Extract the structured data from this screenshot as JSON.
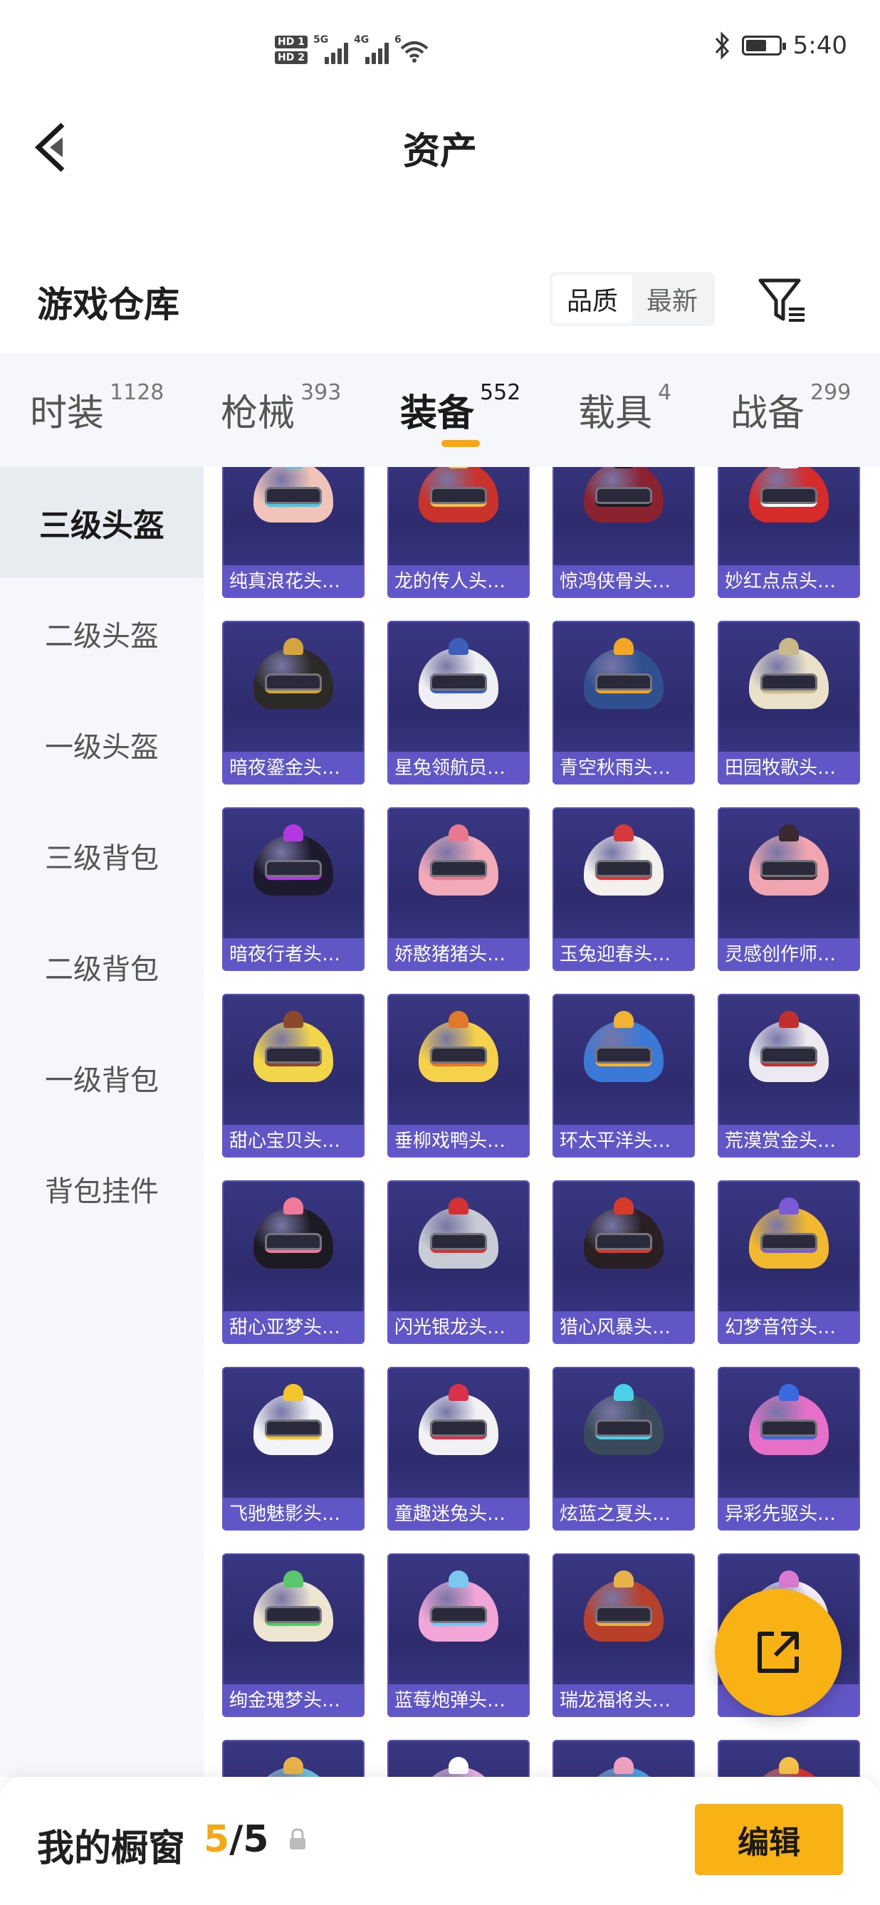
{
  "status_bar": {
    "hd1": "HD 1",
    "hd2": "HD 2",
    "net1": "5G",
    "net2": "4G",
    "wifi": "6",
    "time": "5:40"
  },
  "nav": {
    "title": "资产"
  },
  "warehouse": {
    "title": "游戏仓库",
    "sort_options": [
      "品质",
      "最新"
    ],
    "sort_selected": "品质"
  },
  "tabs": [
    {
      "label": "时装",
      "count": "1128"
    },
    {
      "label": "枪械",
      "count": "393"
    },
    {
      "label": "装备",
      "count": "552"
    },
    {
      "label": "载具",
      "count": "4"
    },
    {
      "label": "战备",
      "count": "299"
    }
  ],
  "active_tab": "装备",
  "sidebar": {
    "items": [
      "三级头盔",
      "二级头盔",
      "一级头盔",
      "三级背包",
      "二级背包",
      "一级背包",
      "背包挂件"
    ],
    "active": "三级头盔"
  },
  "items": [
    {
      "name": "纯真浪花头…",
      "color": "#f0c4b8",
      "accent": "#49c8e0"
    },
    {
      "name": "龙的传人头…",
      "color": "#c9332b",
      "accent": "#f0c14a"
    },
    {
      "name": "惊鸿侠骨头…",
      "color": "#8a2230",
      "accent": "#1c1c1c"
    },
    {
      "name": "妙红点点头…",
      "color": "#d62b2b",
      "accent": "#ffffff"
    },
    {
      "name": "暗夜鎏金头…",
      "color": "#2c2a26",
      "accent": "#d3a53c"
    },
    {
      "name": "星兔领航员…",
      "color": "#f0f0f4",
      "accent": "#3d5fb8"
    },
    {
      "name": "青空秋雨头…",
      "color": "#2f4f8f",
      "accent": "#f2a623"
    },
    {
      "name": "田园牧歌头…",
      "color": "#e9e2c8",
      "accent": "#c9b98a"
    },
    {
      "name": "暗夜行者头…",
      "color": "#1e1a2e",
      "accent": "#b23ae0"
    },
    {
      "name": "娇憨猪猪头…",
      "color": "#f2a9b8",
      "accent": "#e6788f"
    },
    {
      "name": "玉兔迎春头…",
      "color": "#f4f0ee",
      "accent": "#d63a3a"
    },
    {
      "name": "灵感创作师…",
      "color": "#f0a5b0",
      "accent": "#3a2a30"
    },
    {
      "name": "甜心宝贝头…",
      "color": "#f2d64a",
      "accent": "#8a4a2a"
    },
    {
      "name": "垂柳戏鸭头…",
      "color": "#f6d14a",
      "accent": "#e07a2a"
    },
    {
      "name": "环太平洋头…",
      "color": "#3a7ad6",
      "accent": "#f2b233"
    },
    {
      "name": "荒漠赏金头…",
      "color": "#eceaf0",
      "accent": "#c22f2f"
    },
    {
      "name": "甜心亚梦头…",
      "color": "#1c1a22",
      "accent": "#f07a9a"
    },
    {
      "name": "闪光银龙头…",
      "color": "#c8ccd4",
      "accent": "#d23232"
    },
    {
      "name": "猎心风暴头…",
      "color": "#2a2024",
      "accent": "#d83a2a"
    },
    {
      "name": "幻梦音符头…",
      "color": "#f2b82e",
      "accent": "#7a5ad6"
    },
    {
      "name": "飞驰魅影头…",
      "color": "#f4f4f8",
      "accent": "#f2c62a"
    },
    {
      "name": "童趣迷兔头…",
      "color": "#f2f2f4",
      "accent": "#d8324a"
    },
    {
      "name": "炫蓝之夏头…",
      "color": "#3a4a5a",
      "accent": "#4ad0e8"
    },
    {
      "name": "异彩先驱头…",
      "color": "#e670c8",
      "accent": "#3a6ae0"
    },
    {
      "name": "绚金瑰梦头…",
      "color": "#efe6d2",
      "accent": "#5ac86a"
    },
    {
      "name": "蓝莓炮弹头…",
      "color": "#f2a6d8",
      "accent": "#7ac8f0"
    },
    {
      "name": "瑞龙福将头…",
      "color": "#b8402a",
      "accent": "#e8b248"
    },
    {
      "name": "",
      "color": "#f4eef8",
      "accent": "#d97ad0"
    },
    {
      "name": "",
      "color": "#6ac0e0",
      "accent": "#e8b24a"
    },
    {
      "name": "",
      "color": "#e6b0e0",
      "accent": "#ffffff"
    },
    {
      "name": "",
      "color": "#4aa0e0",
      "accent": "#f0a0c0"
    },
    {
      "name": "",
      "color": "#d8322a",
      "accent": "#f2c24a"
    }
  ],
  "showcase": {
    "label": "我的橱窗",
    "current": "5",
    "separator": "/",
    "total": "5",
    "edit_label": "编辑"
  }
}
